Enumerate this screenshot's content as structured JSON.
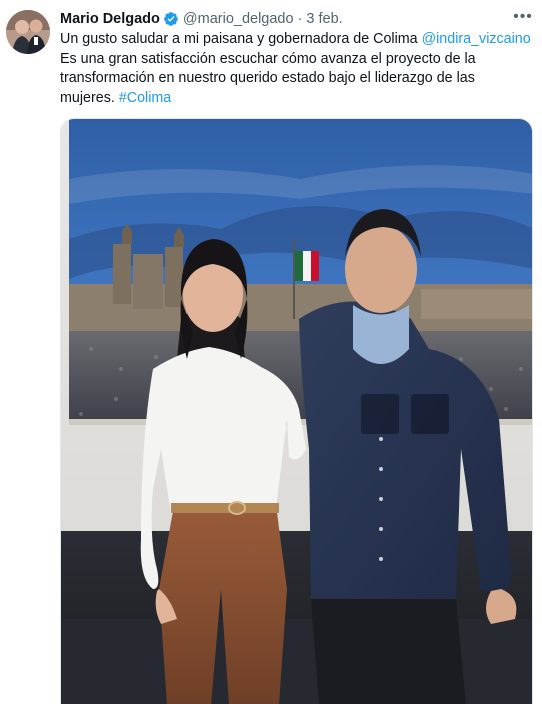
{
  "tweet": {
    "author_name": "Mario Delgado",
    "handle": "@mario_delgado",
    "separator": "·",
    "date": "3 feb.",
    "more_label": "•••",
    "line1_text": "Un gusto saludar a mi paisana y gobernadora de Colima ",
    "mention": "@indira_vizcaino",
    "line2_text": "Es una gran satisfacción escuchar cómo avanza el proyecto de la",
    "line3_text": "transformación en nuestro querido estado bajo el liderazgo de las",
    "line4_text": "mujeres. ",
    "hashtag": "#Colima"
  },
  "colors": {
    "link": "#1d9bf0",
    "verified_badge": "#1d9bf0",
    "secondary_text": "#536471",
    "primary_text": "#0f1419"
  },
  "icons": {
    "verified": "verified-badge-icon",
    "more": "more-horizontal-icon"
  }
}
